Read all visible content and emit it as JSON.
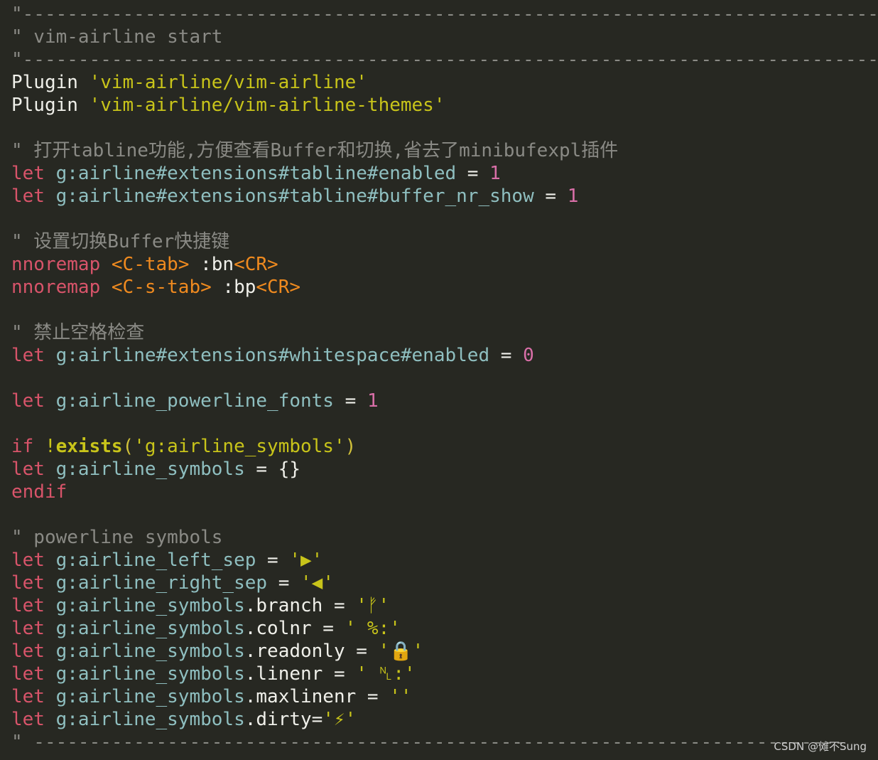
{
  "editor": {
    "lines": [
      {
        "parts": [
          {
            "cls": "comment",
            "text": "\"-----------------------------------------------------------------------------"
          }
        ]
      },
      {
        "parts": [
          {
            "cls": "comment",
            "text": "\" vim-airline start"
          }
        ]
      },
      {
        "parts": [
          {
            "cls": "comment",
            "text": "\"-----------------------------------------------------------------------------"
          }
        ]
      },
      {
        "parts": [
          {
            "cls": "plain",
            "text": "Plugin "
          },
          {
            "cls": "str",
            "text": "'vim-airline/vim-airline'"
          }
        ]
      },
      {
        "parts": [
          {
            "cls": "plain",
            "text": "Plugin "
          },
          {
            "cls": "str",
            "text": "'vim-airline/vim-airline-themes'"
          }
        ]
      },
      {
        "parts": [
          {
            "cls": "plain",
            "text": ""
          }
        ]
      },
      {
        "parts": [
          {
            "cls": "comment",
            "text": "\" 打开tabline功能,方便查看Buffer和切换,省去了minibufexpl插件"
          }
        ]
      },
      {
        "parts": [
          {
            "cls": "kw",
            "text": "let "
          },
          {
            "cls": "var",
            "text": "g:airline#extensions#tabline#enabled"
          },
          {
            "cls": "plain",
            "text": " = "
          },
          {
            "cls": "num",
            "text": "1"
          }
        ]
      },
      {
        "parts": [
          {
            "cls": "kw",
            "text": "let "
          },
          {
            "cls": "var",
            "text": "g:airline#extensions#tabline#buffer_nr_show"
          },
          {
            "cls": "plain",
            "text": " = "
          },
          {
            "cls": "num",
            "text": "1"
          }
        ]
      },
      {
        "parts": [
          {
            "cls": "plain",
            "text": ""
          }
        ]
      },
      {
        "parts": [
          {
            "cls": "comment",
            "text": "\" 设置切换Buffer快捷键"
          }
        ]
      },
      {
        "parts": [
          {
            "cls": "kw",
            "text": "nnoremap "
          },
          {
            "cls": "orange",
            "text": "<C-tab>"
          },
          {
            "cls": "plain",
            "text": " :bn"
          },
          {
            "cls": "orange",
            "text": "<CR>"
          }
        ]
      },
      {
        "parts": [
          {
            "cls": "kw",
            "text": "nnoremap "
          },
          {
            "cls": "orange",
            "text": "<C-s-tab>"
          },
          {
            "cls": "plain",
            "text": " :bp"
          },
          {
            "cls": "orange",
            "text": "<CR>"
          }
        ]
      },
      {
        "parts": [
          {
            "cls": "plain",
            "text": ""
          }
        ]
      },
      {
        "parts": [
          {
            "cls": "comment",
            "text": "\" 禁止空格检查"
          }
        ]
      },
      {
        "parts": [
          {
            "cls": "kw",
            "text": "let "
          },
          {
            "cls": "var",
            "text": "g:airline#extensions#whitespace#enabled"
          },
          {
            "cls": "plain",
            "text": " = "
          },
          {
            "cls": "num",
            "text": "0"
          }
        ]
      },
      {
        "parts": [
          {
            "cls": "plain",
            "text": ""
          }
        ]
      },
      {
        "parts": [
          {
            "cls": "kw",
            "text": "let "
          },
          {
            "cls": "var",
            "text": "g:airline_powerline_fonts"
          },
          {
            "cls": "plain",
            "text": " = "
          },
          {
            "cls": "num",
            "text": "1"
          }
        ]
      },
      {
        "parts": [
          {
            "cls": "plain",
            "text": ""
          }
        ]
      },
      {
        "parts": [
          {
            "cls": "kw",
            "text": "if "
          },
          {
            "cls": "bang",
            "text": "!"
          },
          {
            "cls": "exists",
            "text": "exists"
          },
          {
            "cls": "paren",
            "text": "("
          },
          {
            "cls": "str",
            "text": "'g:airline_symbols'"
          },
          {
            "cls": "paren",
            "text": ")"
          }
        ]
      },
      {
        "parts": [
          {
            "cls": "kw",
            "text": "let "
          },
          {
            "cls": "var",
            "text": "g:airline_symbols"
          },
          {
            "cls": "plain",
            "text": " = {}"
          }
        ]
      },
      {
        "parts": [
          {
            "cls": "kw",
            "text": "endif"
          }
        ]
      },
      {
        "parts": [
          {
            "cls": "plain",
            "text": ""
          }
        ]
      },
      {
        "parts": [
          {
            "cls": "comment",
            "text": "\" powerline symbols"
          }
        ]
      },
      {
        "parts": [
          {
            "cls": "kw",
            "text": "let "
          },
          {
            "cls": "var",
            "text": "g:airline_left_sep"
          },
          {
            "cls": "plain",
            "text": " = "
          },
          {
            "cls": "str",
            "text": "'▶'"
          }
        ]
      },
      {
        "parts": [
          {
            "cls": "kw",
            "text": "let "
          },
          {
            "cls": "var",
            "text": "g:airline_right_sep"
          },
          {
            "cls": "plain",
            "text": " = "
          },
          {
            "cls": "str",
            "text": "'◀'"
          }
        ]
      },
      {
        "parts": [
          {
            "cls": "kw",
            "text": "let "
          },
          {
            "cls": "var",
            "text": "g:airline_symbols"
          },
          {
            "cls": "plain",
            "text": ".branch = "
          },
          {
            "cls": "str",
            "text": "'ᚠ'"
          }
        ]
      },
      {
        "parts": [
          {
            "cls": "kw",
            "text": "let "
          },
          {
            "cls": "var",
            "text": "g:airline_symbols"
          },
          {
            "cls": "plain",
            "text": ".colnr = "
          },
          {
            "cls": "str",
            "text": "' %:'"
          }
        ]
      },
      {
        "parts": [
          {
            "cls": "kw",
            "text": "let "
          },
          {
            "cls": "var",
            "text": "g:airline_symbols"
          },
          {
            "cls": "plain",
            "text": ".readonly = "
          },
          {
            "cls": "str",
            "text": "'🔒'"
          }
        ]
      },
      {
        "parts": [
          {
            "cls": "kw",
            "text": "let "
          },
          {
            "cls": "var",
            "text": "g:airline_symbols"
          },
          {
            "cls": "plain",
            "text": ".linenr = "
          },
          {
            "cls": "str",
            "text": "' ␤:'"
          }
        ]
      },
      {
        "parts": [
          {
            "cls": "kw",
            "text": "let "
          },
          {
            "cls": "var",
            "text": "g:airline_symbols"
          },
          {
            "cls": "plain",
            "text": ".maxlinenr = "
          },
          {
            "cls": "str",
            "text": "''"
          }
        ]
      },
      {
        "parts": [
          {
            "cls": "kw",
            "text": "let "
          },
          {
            "cls": "var",
            "text": "g:airline_symbols"
          },
          {
            "cls": "plain",
            "text": ".dirty="
          },
          {
            "cls": "str",
            "text": "'⚡'"
          }
        ]
      },
      {
        "parts": [
          {
            "cls": "comment",
            "text": "\" -------------------------------------------------------------------------"
          }
        ]
      }
    ]
  },
  "watermark": {
    "text": "CSDN @傩不Sung"
  }
}
